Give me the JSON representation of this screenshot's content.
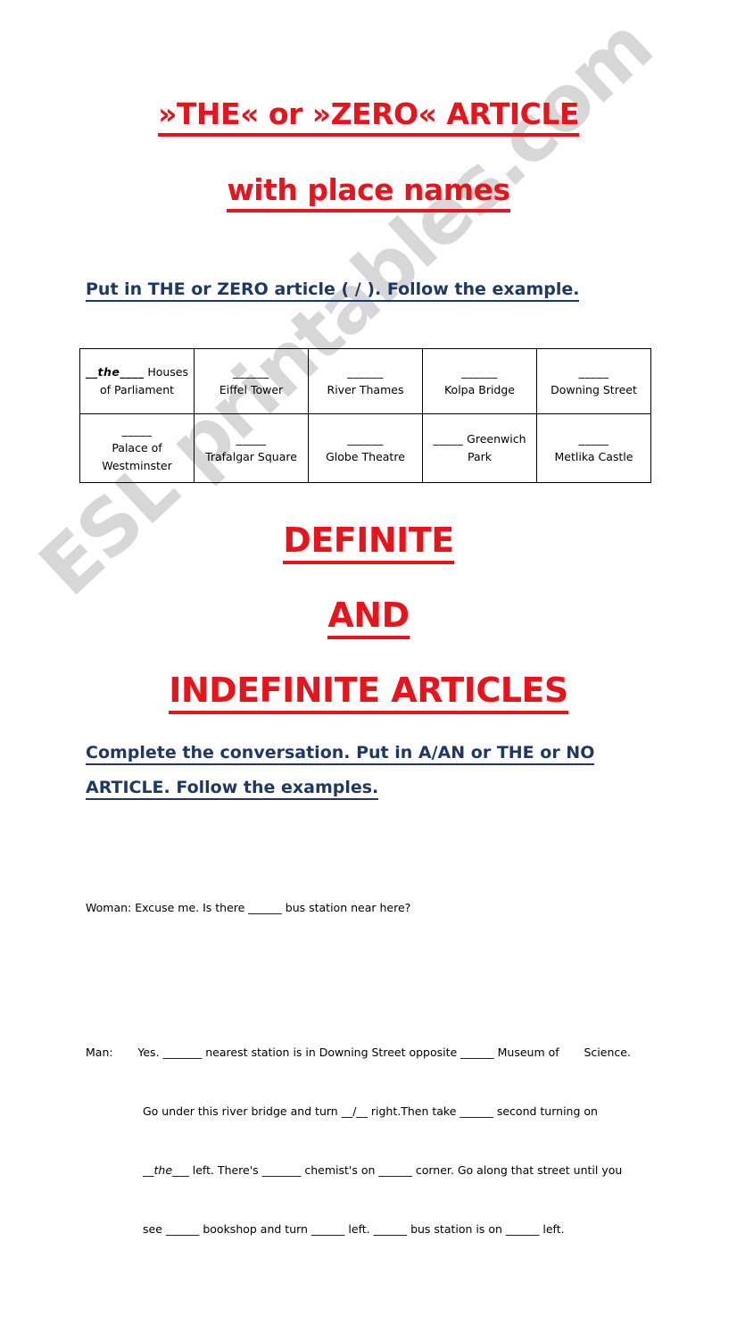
{
  "colors": {
    "title_red": "#e8141b",
    "instruction_blue": "#1f3864",
    "watermark_gray": "#c9c9c9",
    "table_border": "#000000"
  },
  "watermark": {
    "text": "ESL printables.com"
  },
  "title": {
    "line1": "»THE« or »ZERO« ARTICLE",
    "line2": "with place names"
  },
  "instructions": {
    "task1": "Put in THE or ZERO article ( / ). Follow the example.",
    "task2": "Complete the conversation. Put in A/AN or THE or NO ARTICLE. Follow the examples."
  },
  "headings": {
    "definite": "DEFINITE",
    "and": "AND",
    "indefinite": "INDEFINITE ARTICLES"
  },
  "table": {
    "rows": [
      [
        {
          "blank": "__the____",
          "answer": "the",
          "filled": true,
          "inline": true,
          "name": "Houses of Parliament",
          "name_line1": " Houses",
          "name_line2": "of Parliament"
        },
        {
          "blank": "______",
          "filled": false,
          "inline": false,
          "name": "Eiffel Tower"
        },
        {
          "blank": "______",
          "filled": false,
          "inline": false,
          "name": "River Thames"
        },
        {
          "blank": "______",
          "filled": false,
          "inline": false,
          "name": "Kolpa Bridge"
        },
        {
          "blank": "_____",
          "filled": false,
          "inline": false,
          "name": "Downing Street"
        }
      ],
      [
        {
          "blank": "_____",
          "filled": false,
          "inline": false,
          "name": "Palace of Westminster"
        },
        {
          "blank": "_____",
          "filled": false,
          "inline": false,
          "name": "Trafalgar Square"
        },
        {
          "blank": "______",
          "filled": false,
          "inline": false,
          "name": "Globe Theatre"
        },
        {
          "blank": "_____",
          "filled": false,
          "inline": true,
          "name": "Greenwich Park",
          "name_line1": " Greenwich",
          "name_line2": "Park"
        },
        {
          "blank": "_____",
          "filled": false,
          "inline": false,
          "name": "Metlika Castle"
        }
      ]
    ]
  },
  "conversation": {
    "woman_label": "Woman:",
    "woman_line": "Woman: Excuse me. Is there ______ bus station near here?",
    "man_label": "Man:",
    "man_line_1": "Man:       Yes. _______ nearest station is in Downing Street opposite ______ Museum of       Science.",
    "man_line_2": "Go under this river bridge and turn __/__ right.Then take ______ second turning on",
    "man_line_3_pre": "__",
    "man_line_3_answer": "the",
    "man_line_3_post": "___ left. There's _______ chemist's on ______ corner. Go along that street until you",
    "man_line_4": "see ______ bookshop and turn ______ left. ______ bus station is on ______ left."
  }
}
